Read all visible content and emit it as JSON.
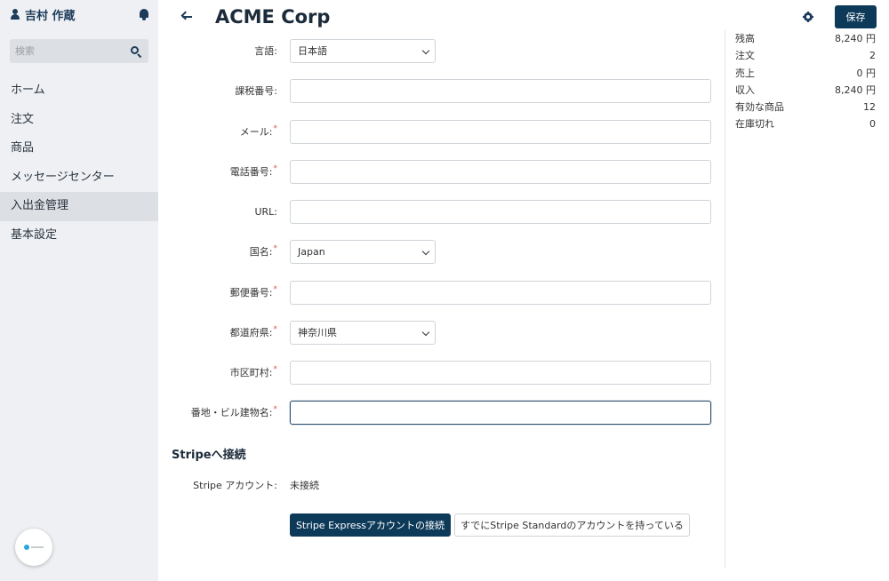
{
  "user": {
    "name": "吉村 作蔵"
  },
  "search": {
    "placeholder": "検索"
  },
  "nav": {
    "items": [
      {
        "label": "ホーム"
      },
      {
        "label": "注文"
      },
      {
        "label": "商品"
      },
      {
        "label": "メッセージセンター"
      },
      {
        "label": "入出金管理",
        "active": true
      },
      {
        "label": "基本設定"
      }
    ]
  },
  "header": {
    "title": "ACME Corp",
    "save_label": "保存"
  },
  "stats": [
    {
      "label": "残高",
      "value": "8,240 円"
    },
    {
      "label": "注文",
      "value": "2"
    },
    {
      "label": "売上",
      "value": "0 円"
    },
    {
      "label": "収入",
      "value": "8,240 円"
    },
    {
      "label": "有効な商品",
      "value": "12"
    },
    {
      "label": "在庫切れ",
      "value": "0"
    }
  ],
  "form": {
    "language": {
      "label": "言語:",
      "value": "日本語"
    },
    "tax_number": {
      "label": "課税番号:",
      "value": ""
    },
    "email": {
      "label": "メール:",
      "required": "*",
      "value": ""
    },
    "phone": {
      "label": "電話番号:",
      "required": "*",
      "value": ""
    },
    "url": {
      "label": "URL:",
      "value": ""
    },
    "country": {
      "label": "国名:",
      "required": "*",
      "value": "Japan"
    },
    "postal_code": {
      "label": "郵便番号:",
      "required": "*",
      "value": ""
    },
    "prefecture": {
      "label": "都道府県:",
      "required": "*",
      "value": "神奈川県"
    },
    "city": {
      "label": "市区町村:",
      "required": "*",
      "value": ""
    },
    "address": {
      "label": "番地・ビル建物名:",
      "required": "*",
      "value": ""
    }
  },
  "stripe": {
    "section_title": "Stripeへ接続",
    "account_label": "Stripe アカウント:",
    "account_status": "未接続",
    "connect_express_label": "Stripe Expressアカウントの接続",
    "have_standard_label": "すでにStripe Standardのアカウントを持っている"
  },
  "colors": {
    "accent": "#0e3a5a",
    "sidebar_bg": "#eef0f3",
    "required": "#d9534f"
  }
}
